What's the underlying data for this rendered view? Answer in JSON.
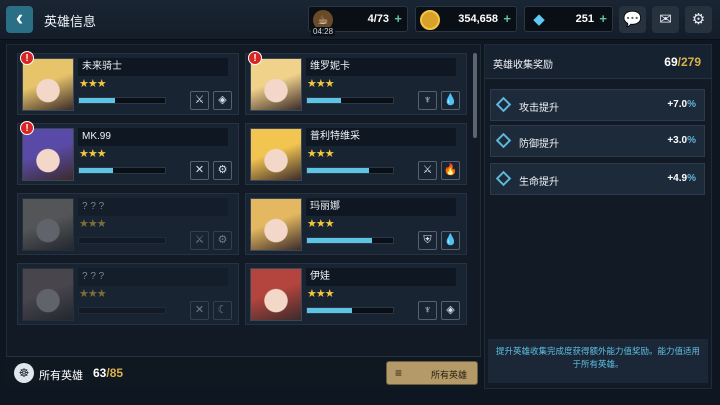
{
  "header": {
    "back_icon": "chevron-left-icon",
    "title": "英雄信息"
  },
  "resources": {
    "stamina": {
      "icon": "coffee-cup-icon",
      "value": "4/73",
      "timer": "04:28"
    },
    "gold": {
      "icon": "coin-icon",
      "value": "354,658"
    },
    "gems": {
      "icon": "gem-icon",
      "value": "251"
    }
  },
  "heroes": [
    {
      "name": "未来骑士",
      "stars": "★★★",
      "alert": "!",
      "progress": 0.42,
      "role_icon": "crossed-swords-icon",
      "element_icon": "diamond-element-icon",
      "locked": false
    },
    {
      "name": "维罗妮卡",
      "stars": "★★★",
      "alert": "!",
      "progress": 0.4,
      "role_icon": "wings-icon",
      "element_icon": "water-drop-icon",
      "locked": false
    },
    {
      "name": "MK.99",
      "stars": "★★★",
      "alert": "!",
      "progress": 0.4,
      "role_icon": "crossed-swords-broken-icon",
      "element_icon": "gear-element-icon",
      "locked": false
    },
    {
      "name": "普利特维采",
      "stars": "★★★",
      "alert": "",
      "progress": 0.72,
      "role_icon": "crossed-swords-icon",
      "element_icon": "fire-icon",
      "locked": false
    },
    {
      "name": "? ? ?",
      "stars": "★★★",
      "alert": "",
      "progress": 0,
      "role_icon": "crossed-swords-icon",
      "element_icon": "gear-element-icon",
      "locked": true
    },
    {
      "name": "玛丽娜",
      "stars": "★★★",
      "alert": "",
      "progress": 0.75,
      "role_icon": "shield-icon",
      "element_icon": "water-drop-icon",
      "locked": false
    },
    {
      "name": "? ? ?",
      "stars": "★★★",
      "alert": "",
      "progress": 0,
      "role_icon": "crossed-swords-broken-icon",
      "element_icon": "moon-icon",
      "locked": true
    },
    {
      "name": "伊娃",
      "stars": "★★★",
      "alert": "",
      "progress": 0.52,
      "role_icon": "wings-icon",
      "element_icon": "diamond-element-icon",
      "locked": false
    }
  ],
  "footer": {
    "label": "所有英雄",
    "count": "63",
    "total": "/85",
    "filter_label": "所有英雄"
  },
  "collection": {
    "title": "英雄收集奖励",
    "count": "69",
    "total": "/279",
    "stats": [
      {
        "label": "攻击提升",
        "value": "+7.0",
        "unit": "%"
      },
      {
        "label": "防御提升",
        "value": "+3.0",
        "unit": "%"
      },
      {
        "label": "生命提升",
        "value": "+4.9",
        "unit": "%"
      }
    ],
    "note": "提升英雄收集完成度获得额外能力值奖励。能力值适用于所有英雄。"
  },
  "colors": {
    "accent": "#5fb7da",
    "star": "#f2c83c",
    "gold_text": "#d9b04a",
    "alert": "#d92424"
  }
}
